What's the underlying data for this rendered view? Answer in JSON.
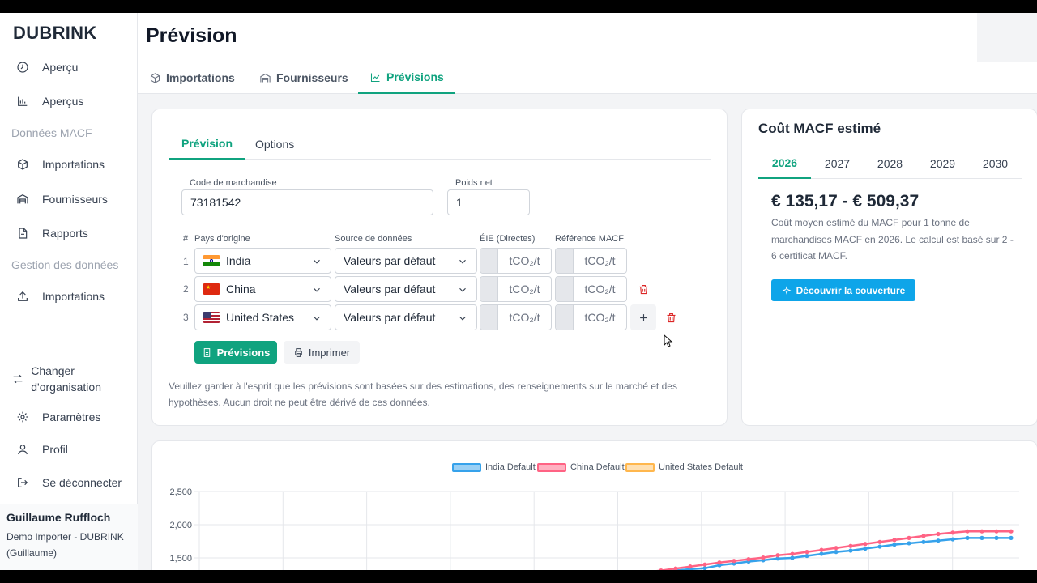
{
  "brand": "DUBRINK",
  "sidebar": {
    "items": [
      {
        "label": "Aperçu",
        "icon": "clock-icon"
      },
      {
        "label": "Aperçus",
        "icon": "bar-chart-icon"
      }
    ],
    "section1": "Données MACF",
    "items2": [
      {
        "label": "Importations",
        "icon": "box-icon"
      },
      {
        "label": "Fournisseurs",
        "icon": "warehouse-icon"
      },
      {
        "label": "Rapports",
        "icon": "file-icon"
      }
    ],
    "section2": "Gestion des données",
    "items3": [
      {
        "label": "Importations",
        "icon": "upload-icon"
      }
    ],
    "bottom": [
      {
        "label": "Changer d'organisation",
        "icon": "swap-icon"
      },
      {
        "label": "Paramètres",
        "icon": "gear-icon"
      },
      {
        "label": "Profil",
        "icon": "user-icon"
      },
      {
        "label": "Se déconnecter",
        "icon": "logout-icon"
      }
    ],
    "user": {
      "name": "Guillaume Ruffloch",
      "org": "Demo Importer - DUBRINK (Guillaume)"
    }
  },
  "header": {
    "title": "Prévision"
  },
  "tabs": [
    {
      "label": "Importations",
      "icon": "box-icon"
    },
    {
      "label": "Fournisseurs",
      "icon": "warehouse-icon"
    },
    {
      "label": "Prévisions",
      "icon": "trend-icon",
      "active": true
    }
  ],
  "forecast": {
    "subtabs": [
      "Prévision",
      "Options"
    ],
    "code_label": "Code de marchandise",
    "code_value": "73181542",
    "weight_label": "Poids net",
    "weight_value": "1",
    "columns": {
      "num": "#",
      "origin": "Pays d'origine",
      "source": "Source de données",
      "see": "ÉIE (Directes)",
      "ref": "Référence MACF"
    },
    "unit": "tCO₂/t",
    "rows": [
      {
        "num": "1",
        "country": "India",
        "source": "Valeurs par défaut"
      },
      {
        "num": "2",
        "country": "China",
        "source": "Valeurs par défaut"
      },
      {
        "num": "3",
        "country": "United States",
        "source": "Valeurs par défaut"
      }
    ],
    "btn_forecast": "Prévisions",
    "btn_print": "Imprimer",
    "disclaimer": "Veuillez garder à l'esprit que les prévisions sont basées sur des estimations, des renseignements sur le marché et des hypothèses. Aucun droit ne peut être dérivé de ces données."
  },
  "cost": {
    "title": "Coût MACF estimé",
    "years": [
      "2026",
      "2027",
      "2028",
      "2029",
      "2030"
    ],
    "active_year": "2026",
    "range": "€ 135,17 - € 509,37",
    "desc": "Coût moyen estimé du MACF pour 1 tonne de marchandises MACF en 2026. Le calcul est basé sur 2 - 6 certificat MACF.",
    "button": "Découvrir la couverture"
  },
  "chart_data": {
    "type": "line",
    "series": [
      {
        "name": "India Default",
        "color": "#36a2eb",
        "values": [
          null,
          null,
          null,
          null,
          null,
          null,
          null,
          null,
          null,
          null,
          null,
          null,
          null,
          null,
          null,
          null,
          null,
          null,
          null,
          null,
          null,
          null,
          null,
          1220,
          1225,
          1250,
          1285,
          1310,
          1330,
          1345,
          1390,
          1415,
          1445,
          1465,
          1490,
          1500,
          1530,
          1560,
          1590,
          1610,
          1640,
          1670,
          1700,
          1720,
          1740,
          1760,
          1780,
          1800,
          1800,
          1800,
          1800
        ]
      },
      {
        "name": "China Default",
        "color": "#ff6384",
        "values": [
          null,
          null,
          null,
          null,
          null,
          null,
          null,
          null,
          null,
          null,
          null,
          null,
          null,
          null,
          null,
          null,
          null,
          null,
          null,
          null,
          null,
          null,
          null,
          1240,
          1260,
          1285,
          1310,
          1340,
          1370,
          1400,
          1430,
          1455,
          1480,
          1505,
          1540,
          1560,
          1590,
          1620,
          1650,
          1680,
          1710,
          1740,
          1770,
          1800,
          1830,
          1860,
          1880,
          1900,
          1900,
          1900,
          1900
        ]
      },
      {
        "name": "United States Default",
        "color": "#ffb74d",
        "values": []
      }
    ],
    "yticks": [
      "2,500",
      "2,000",
      "1,500"
    ],
    "ylim": [
      1000,
      2500
    ]
  }
}
